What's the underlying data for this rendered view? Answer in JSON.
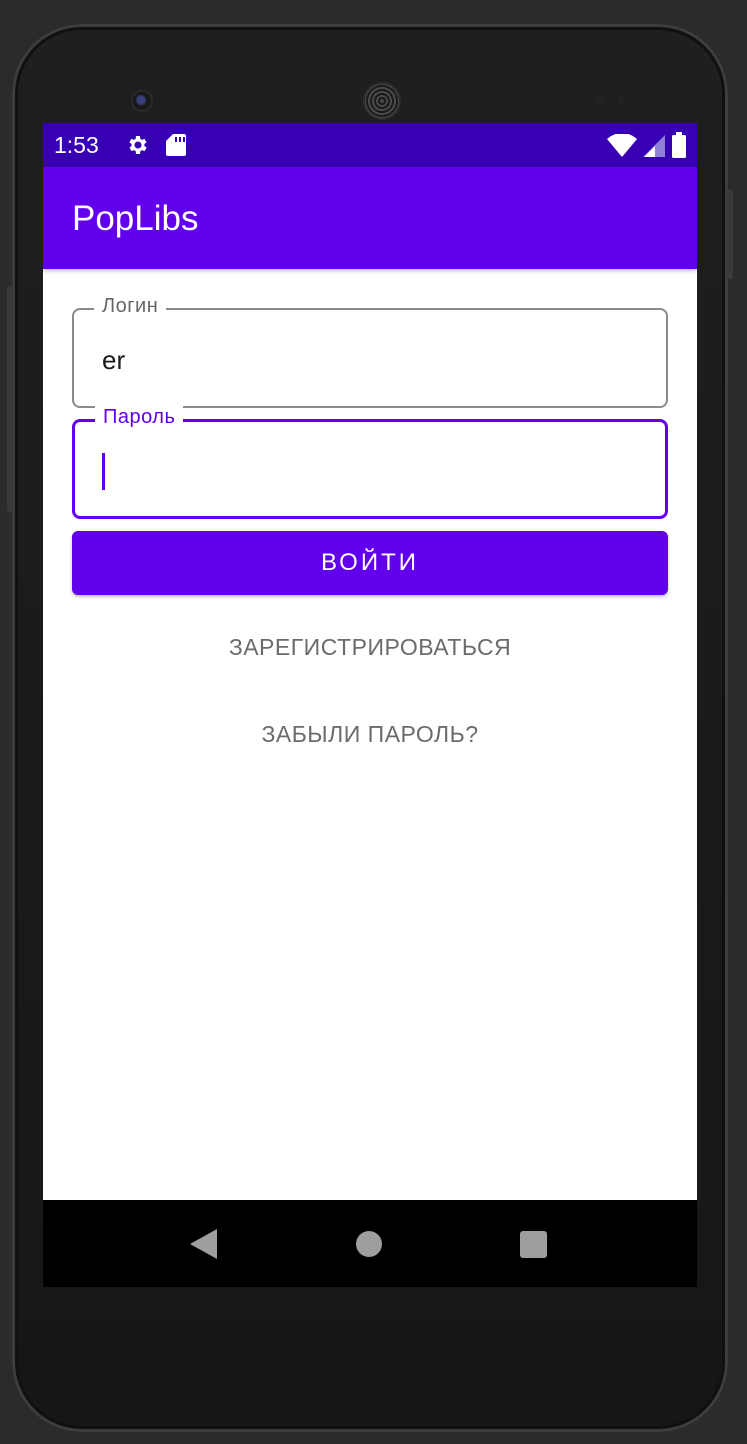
{
  "status_bar": {
    "time": "1:53",
    "icons_left": [
      "settings-icon",
      "sd-card-icon"
    ],
    "icons_right": [
      "wifi-icon",
      "signal-icon",
      "battery-icon"
    ],
    "color": "#3700b3"
  },
  "app_bar": {
    "title": "PopLibs",
    "color": "#6200ee"
  },
  "form": {
    "login": {
      "label": "Логин",
      "value": "er"
    },
    "password": {
      "label": "Пароль",
      "value": ""
    },
    "login_button": "ВОЙТИ",
    "register_button": "ЗАРЕГИСТРИРОВАТЬСЯ",
    "forgot_button": "ЗАБЫЛИ ПАРОЛЬ?"
  },
  "nav_bar": {
    "buttons": [
      "back-icon",
      "home-icon",
      "recent-apps-icon"
    ]
  },
  "colors": {
    "accent": "#6200ee",
    "text_button": "#6b6b6b"
  }
}
